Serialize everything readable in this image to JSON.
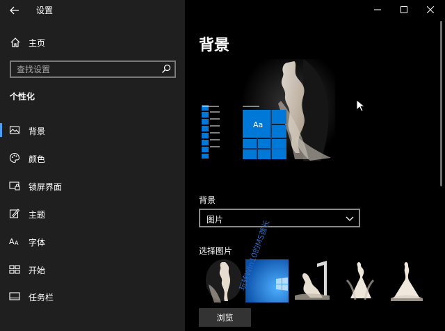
{
  "window": {
    "title": "设置",
    "controls": [
      "minimize-icon",
      "maximize-icon",
      "close-icon"
    ]
  },
  "sidebar": {
    "home_label": "主页",
    "search_placeholder": "查找设置",
    "section_title": "个性化",
    "items": [
      {
        "label": "背景",
        "icon": "image-icon",
        "active": true
      },
      {
        "label": "颜色",
        "icon": "palette-icon",
        "active": false
      },
      {
        "label": "锁屏界面",
        "icon": "lock-screen-icon",
        "active": false
      },
      {
        "label": "主题",
        "icon": "theme-brush-icon",
        "active": false
      },
      {
        "label": "字体",
        "icon": "font-icon",
        "active": false
      },
      {
        "label": "开始",
        "icon": "start-icon",
        "active": false
      },
      {
        "label": "任务栏",
        "icon": "taskbar-icon",
        "active": false
      }
    ]
  },
  "main": {
    "page_title": "背景",
    "preview_tile_text": "Aa",
    "background_label": "背景",
    "background_dropdown_value": "图片",
    "choose_picture_label": "选择图片",
    "browse_label": "浏览",
    "watermark_text": "玩转Win10的MS酋长"
  },
  "colors": {
    "sidebar_bg": "#1f1f1f",
    "content_bg": "#000000",
    "accent": "#0078d7",
    "active_indicator": "#4a9ff5"
  }
}
